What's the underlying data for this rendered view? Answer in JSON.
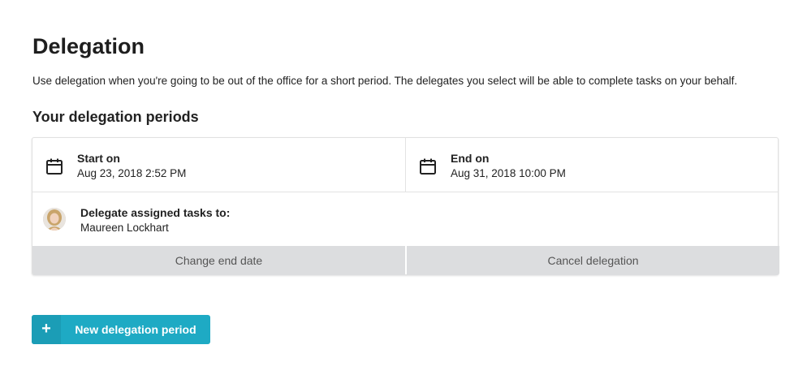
{
  "page": {
    "title": "Delegation",
    "description": "Use delegation when you're going to be out of the office for a short period. The delegates you select will be able to complete tasks on your behalf."
  },
  "section": {
    "title": "Your delegation periods"
  },
  "delegation_period": {
    "start": {
      "label": "Start on",
      "value": "Aug 23, 2018 2:52 PM",
      "icon": "calendar-icon"
    },
    "end": {
      "label": "End on",
      "value": "Aug 31, 2018 10:00 PM",
      "icon": "calendar-icon"
    },
    "delegate": {
      "label": "Delegate assigned tasks to:",
      "name": "Maureen Lockhart",
      "icon": "avatar"
    },
    "actions": {
      "change_end_date": "Change end date",
      "cancel_delegation": "Cancel delegation"
    }
  },
  "new_delegation": {
    "icon_glyph": "+",
    "label": "New delegation period",
    "color": "#1eaac4"
  }
}
